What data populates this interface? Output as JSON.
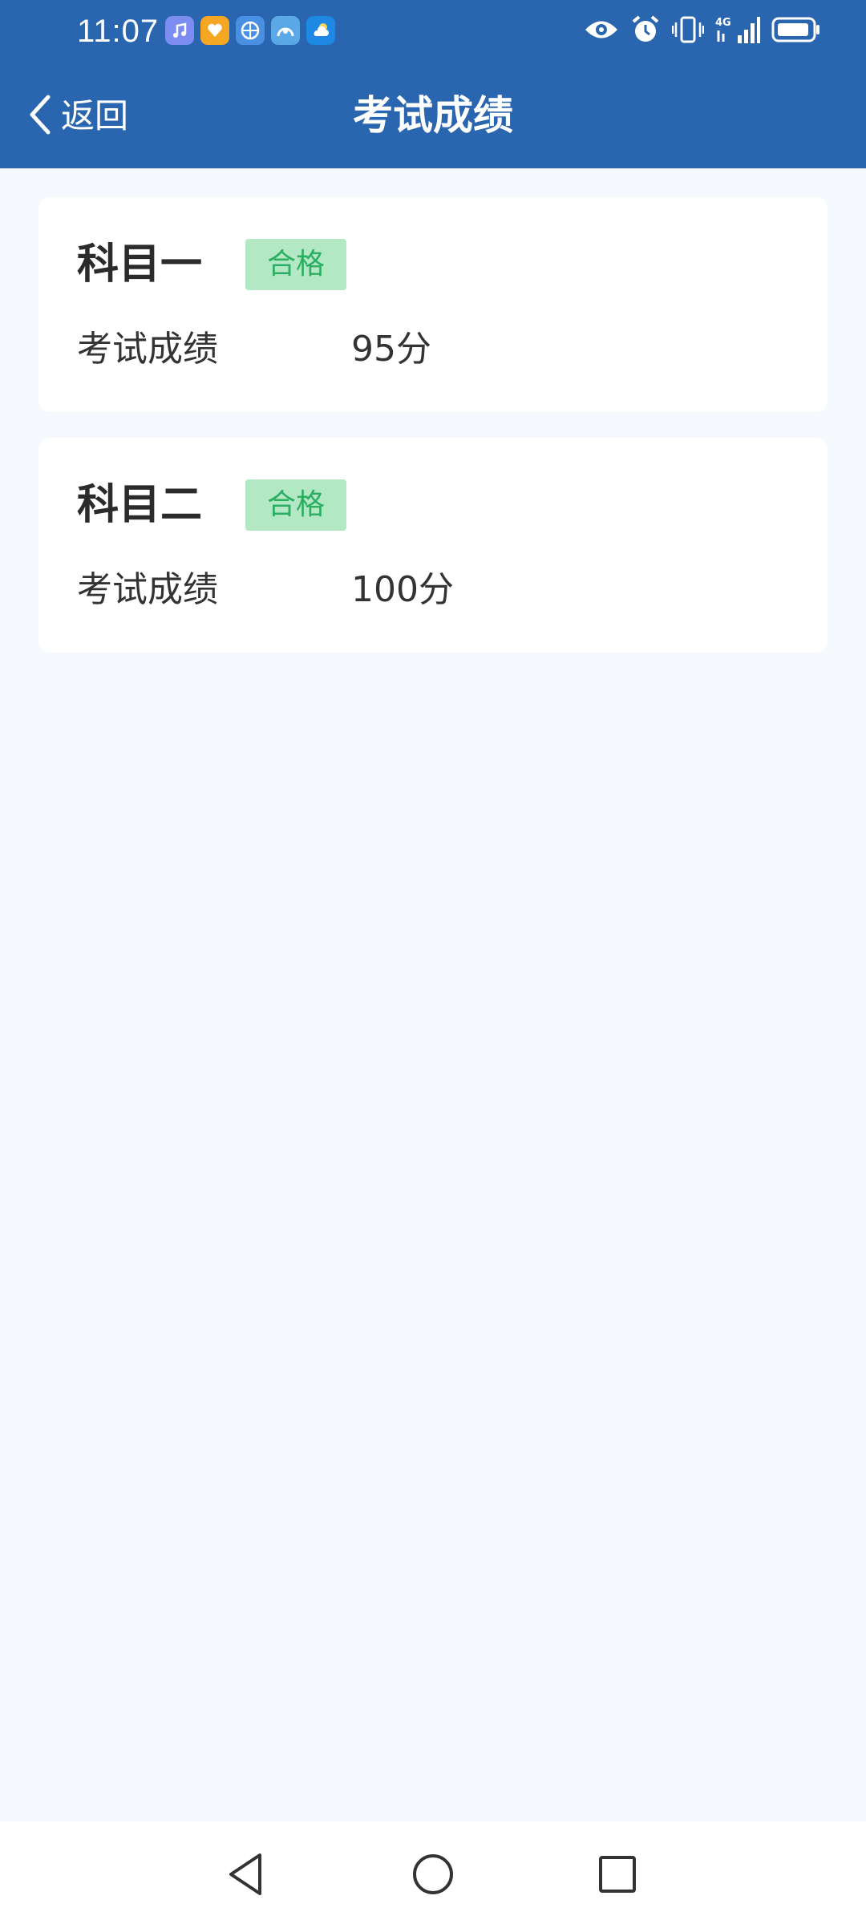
{
  "status_bar": {
    "time": "11:07",
    "app_icons": [
      "music-app-icon",
      "heart-app-icon",
      "browser-app-icon",
      "photo-app-icon",
      "weather-app-icon"
    ],
    "right_icons": [
      "eye-icon",
      "alarm-icon",
      "vibrate-icon",
      "signal-4g-icon",
      "battery-icon"
    ]
  },
  "header": {
    "back_label": "返回",
    "title": "考试成绩"
  },
  "results": [
    {
      "subject": "科目一",
      "status": "合格",
      "score_label": "考试成绩",
      "score": "95分"
    },
    {
      "subject": "科目二",
      "status": "合格",
      "score_label": "考试成绩",
      "score": "100分"
    }
  ],
  "nav": [
    "back-nav-icon",
    "home-nav-icon",
    "recents-nav-icon"
  ],
  "colors": {
    "header_bg": "#2a66b0",
    "page_bg": "#f5f9fe",
    "badge_bg": "#b3e8c5",
    "badge_text": "#2cae62"
  }
}
